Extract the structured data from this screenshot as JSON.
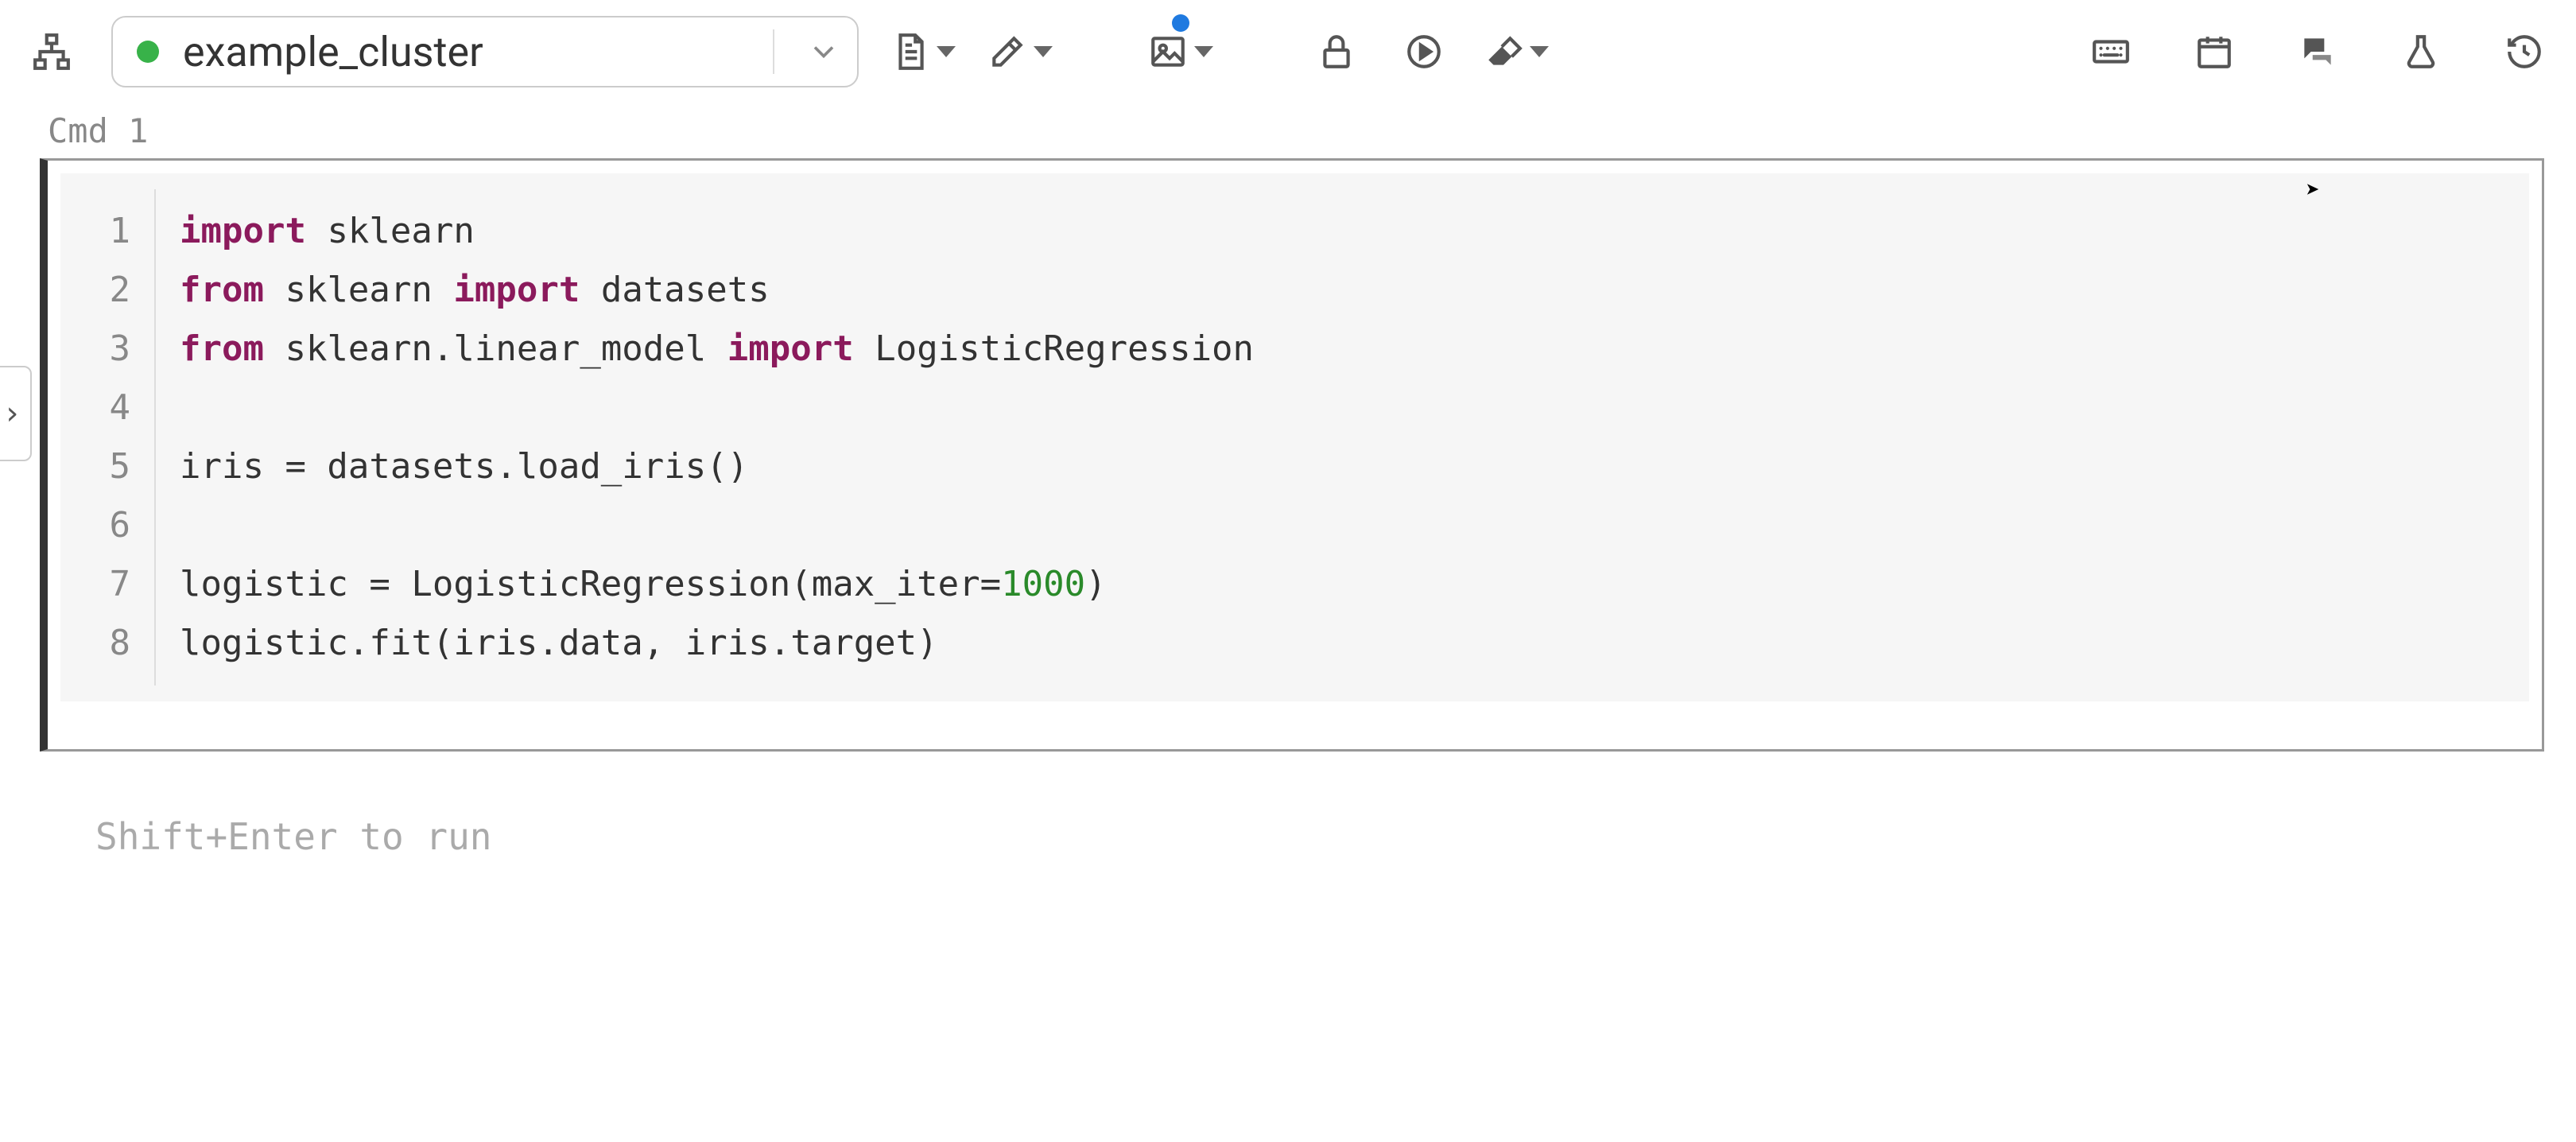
{
  "toolbar": {
    "cluster_name": "example_cluster",
    "cluster_status": "running"
  },
  "cell": {
    "label": "Cmd 1",
    "lines": [
      [
        {
          "t": "import",
          "c": "kw"
        },
        {
          "t": " sklearn",
          "c": ""
        }
      ],
      [
        {
          "t": "from",
          "c": "kw"
        },
        {
          "t": " sklearn ",
          "c": ""
        },
        {
          "t": "import",
          "c": "kw"
        },
        {
          "t": " datasets",
          "c": ""
        }
      ],
      [
        {
          "t": "from",
          "c": "kw"
        },
        {
          "t": " sklearn.linear_model ",
          "c": ""
        },
        {
          "t": "import",
          "c": "kw"
        },
        {
          "t": " LogisticRegression",
          "c": ""
        }
      ],
      [],
      [
        {
          "t": "iris = datasets.load_iris()",
          "c": ""
        }
      ],
      [],
      [
        {
          "t": "logistic = LogisticRegression(max_iter=",
          "c": ""
        },
        {
          "t": "1000",
          "c": "num"
        },
        {
          "t": ")",
          "c": ""
        }
      ],
      [
        {
          "t": "logistic.fit(iris.data, iris.target)",
          "c": ""
        }
      ]
    ]
  },
  "hint": "Shift+Enter to run",
  "icons": {
    "hierarchy": "hierarchy-icon",
    "doc": "document-icon",
    "edit": "edit-icon",
    "image": "image-icon",
    "lock": "lock-icon",
    "play": "play-icon",
    "erase": "eraser-icon",
    "keyboard": "keyboard-icon",
    "schedule": "schedule-icon",
    "comments": "comments-icon",
    "experiment": "experiment-icon",
    "history": "history-icon"
  }
}
